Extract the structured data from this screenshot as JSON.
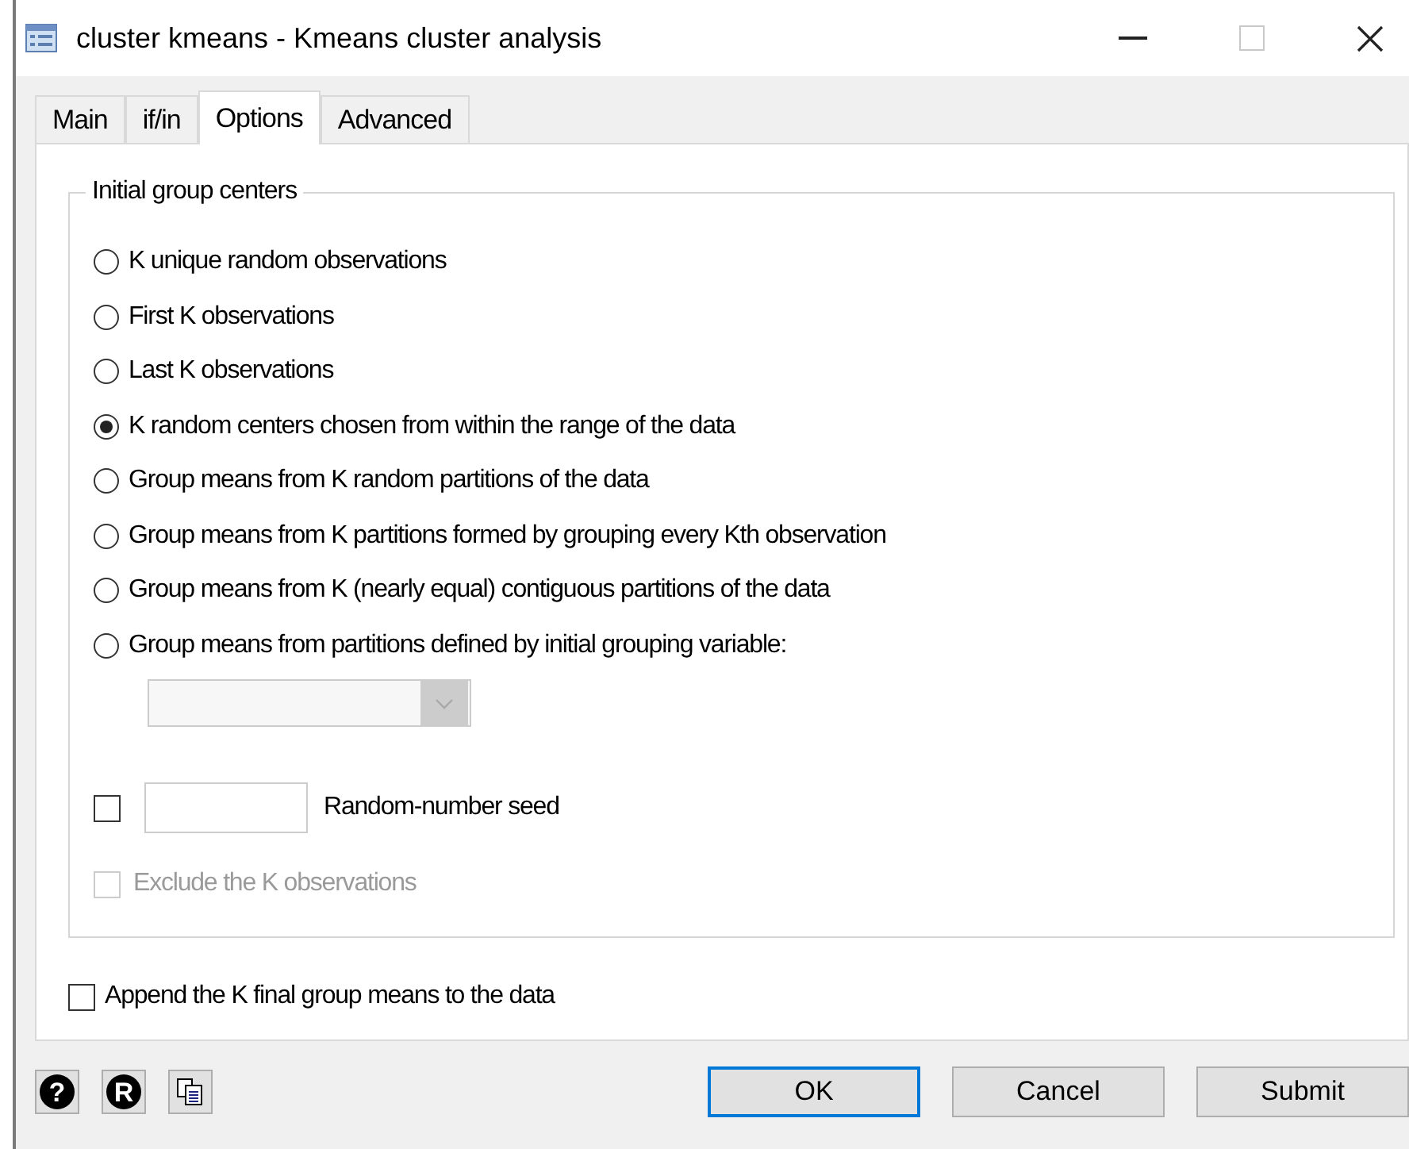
{
  "window": {
    "title": "cluster kmeans - Kmeans cluster analysis"
  },
  "tabs": [
    {
      "label": "Main",
      "selected": false
    },
    {
      "label": "if/in",
      "selected": false
    },
    {
      "label": "Options",
      "selected": true
    },
    {
      "label": "Advanced",
      "selected": false
    }
  ],
  "group": {
    "title": "Initial group centers",
    "options": [
      {
        "label": "K unique random observations",
        "selected": false
      },
      {
        "label": "First K observations",
        "selected": false
      },
      {
        "label": "Last K observations",
        "selected": false
      },
      {
        "label": "K random centers chosen from within the range of the data",
        "selected": true
      },
      {
        "label": "Group means from K random partitions of the data",
        "selected": false
      },
      {
        "label": "Group means from K partitions formed by grouping every Kth observation",
        "selected": false
      },
      {
        "label": "Group means from K (nearly equal) contiguous partitions of the data",
        "selected": false
      },
      {
        "label": "Group means from partitions defined by initial grouping variable:",
        "selected": false
      }
    ],
    "variable_dropdown": {
      "disabled": true
    },
    "seed": {
      "label": "Random-number seed",
      "checked": false
    },
    "exclude": {
      "label": "Exclude the K observations",
      "checked": false,
      "disabled": true
    }
  },
  "append": {
    "label": "Append the K final group means to the data",
    "checked": false
  },
  "footer": {
    "help_glyph": "?",
    "r_glyph": "R"
  },
  "buttons": [
    {
      "label": "OK",
      "default": true
    },
    {
      "label": "Cancel",
      "default": false
    },
    {
      "label": "Submit",
      "default": false
    }
  ]
}
